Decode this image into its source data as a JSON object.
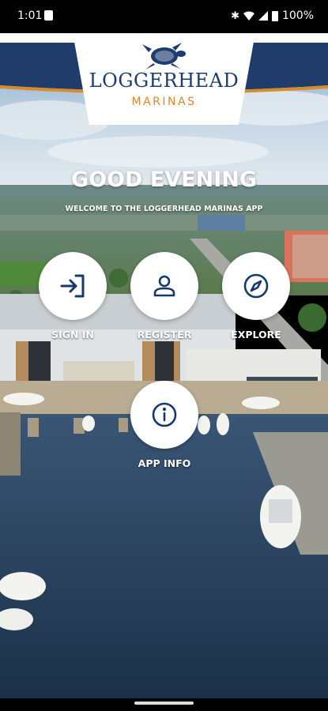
{
  "status_bar": {
    "time": "1:01",
    "battery": "100%"
  },
  "logo": {
    "title": "LOGGERHEAD",
    "subtitle": "MARINAS",
    "icon": "sea-turtle-icon"
  },
  "greeting": "GOOD EVENING",
  "welcome": "WELCOME TO THE LOGGERHEAD MARINAS APP",
  "actions": [
    {
      "label": "SIGN IN",
      "icon": "sign-in-icon"
    },
    {
      "label": "REGISTER",
      "icon": "person-icon"
    },
    {
      "label": "EXPLORE",
      "icon": "compass-icon"
    },
    {
      "label": "APP INFO",
      "icon": "info-icon"
    }
  ],
  "colors": {
    "navy": "#1c3d6e",
    "orange": "#d98a2a",
    "icon": "#17386a"
  }
}
